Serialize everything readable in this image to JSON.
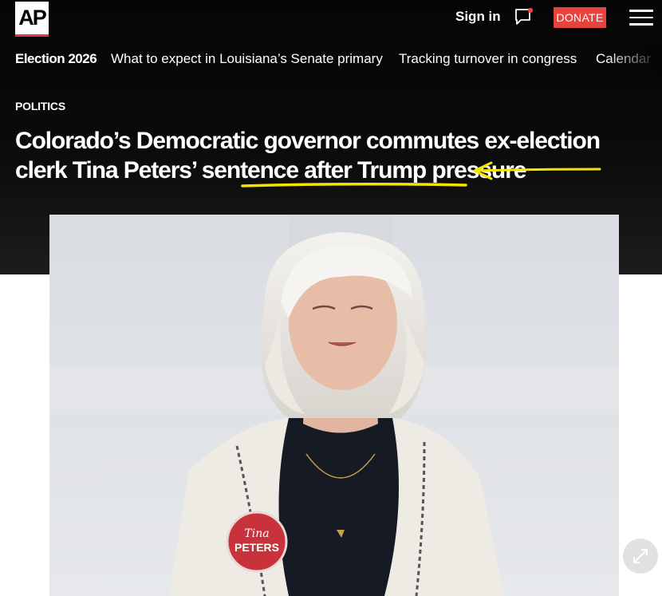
{
  "header": {
    "logo_text": "AP",
    "sign_in_label": "Sign in",
    "donate_label": "DONATE",
    "icons": [
      "chat-icon",
      "menu-icon"
    ]
  },
  "nav": {
    "items": [
      {
        "label": "Election 2026"
      },
      {
        "label": "What to expect in Louisiana’s Senate primary"
      },
      {
        "label": "Tracking turnover in congress"
      },
      {
        "label": "Calendar"
      }
    ]
  },
  "article": {
    "section": "POLITICS",
    "headline_part1": "Colorado’s Democratic governor commutes ex-election clerk Tina Peters’ sentence ",
    "headline_highlight": "after Trump pressure",
    "button_text_line1": "Tina",
    "button_text_line2": "PETERS"
  },
  "colors": {
    "accent_red": "#e8413e",
    "annotation_yellow": "#f5e400",
    "hero_background": "#050505"
  }
}
